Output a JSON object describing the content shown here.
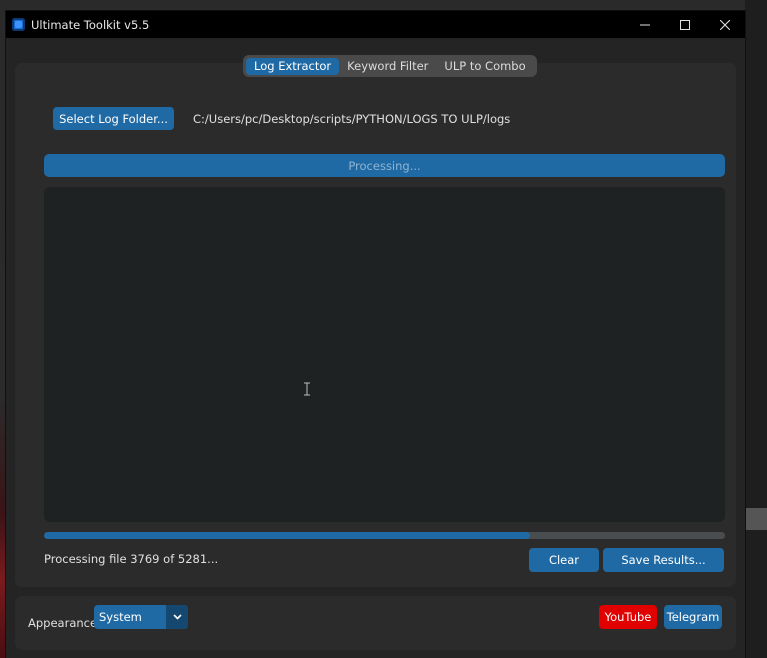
{
  "window": {
    "title": "Ultimate Toolkit v5.5"
  },
  "tabs": [
    {
      "label": "Log Extractor",
      "active": true
    },
    {
      "label": "Keyword Filter",
      "active": false
    },
    {
      "label": "ULP to Combo",
      "active": false
    }
  ],
  "extractor": {
    "select_folder_label": "Select Log Folder...",
    "folder_path": "C:/Users/pc/Desktop/scripts/PYTHON/LOGS TO ULP/logs",
    "processing_label": "Processing...",
    "results_text": "",
    "progress_percent": 71.4,
    "status_text": "Processing file 3769 of 5281...",
    "clear_label": "Clear",
    "save_label": "Save Results..."
  },
  "footer": {
    "appearance_label": "Appearance:",
    "appearance_value": "System",
    "youtube_label": "YouTube",
    "telegram_label": "Telegram"
  },
  "colors": {
    "accent": "#1f6aa5",
    "youtube": "#e00000",
    "background": "#242424",
    "panel": "#2b2b2b",
    "textbox": "#1f2222"
  },
  "icons": {
    "app": "app-icon",
    "minimize": "minimize-icon",
    "maximize": "maximize-icon",
    "close": "close-icon",
    "dropdown": "chevron-down-icon",
    "cursor": "text-cursor-icon"
  }
}
